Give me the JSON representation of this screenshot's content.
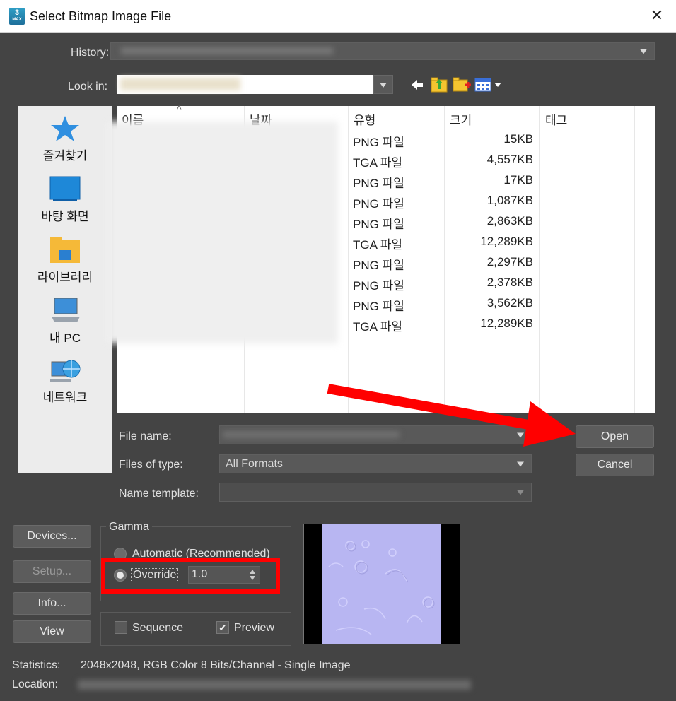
{
  "window": {
    "title": "Select Bitmap Image File",
    "icon_main": "3",
    "icon_sub": "MAX",
    "close": "✕"
  },
  "history": {
    "label": "History:"
  },
  "lookin": {
    "label": "Look in:"
  },
  "places": [
    {
      "label": "즐겨찾기"
    },
    {
      "label": "바탕 화면"
    },
    {
      "label": "라이브러리"
    },
    {
      "label": "내 PC"
    },
    {
      "label": "네트워크"
    }
  ],
  "columns": {
    "name": "이름",
    "date": "날짜",
    "type": "유형",
    "size": "크기",
    "tags": "태그",
    "sort_glyph": "^"
  },
  "files": [
    {
      "type": "PNG 파일",
      "size": "15KB"
    },
    {
      "type": "TGA 파일",
      "size": "4,557KB"
    },
    {
      "type": "PNG 파일",
      "size": "17KB"
    },
    {
      "type": "PNG 파일",
      "size": "1,087KB"
    },
    {
      "type": "PNG 파일",
      "size": "2,863KB"
    },
    {
      "type": "TGA 파일",
      "size": "12,289KB"
    },
    {
      "type": "PNG 파일",
      "size": "2,297KB"
    },
    {
      "type": "PNG 파일",
      "size": "2,378KB"
    },
    {
      "type": "PNG 파일",
      "size": "3,562KB"
    },
    {
      "type": "TGA 파일",
      "size": "12,289KB"
    }
  ],
  "form": {
    "filename_label": "File name:",
    "filetype_label": "Files of type:",
    "filetype_value": "All Formats",
    "nametemplate_label": "Name template:"
  },
  "buttons": {
    "open": "Open",
    "cancel": "Cancel",
    "devices": "Devices...",
    "setup": "Setup...",
    "info": "Info...",
    "view": "View"
  },
  "gamma": {
    "title": "Gamma",
    "automatic": "Automatic (Recommended)",
    "override": "Override",
    "override_value": "1.0"
  },
  "options": {
    "sequence": "Sequence",
    "preview": "Preview",
    "check": "✔"
  },
  "status": {
    "statistics_label": "Statistics:",
    "statistics_value": "2048x2048, RGB Color 8 Bits/Channel - Single Image",
    "location_label": "Location:"
  },
  "colors": {
    "annotation": "#ff0000",
    "normal_map": "#b8b6f2"
  }
}
